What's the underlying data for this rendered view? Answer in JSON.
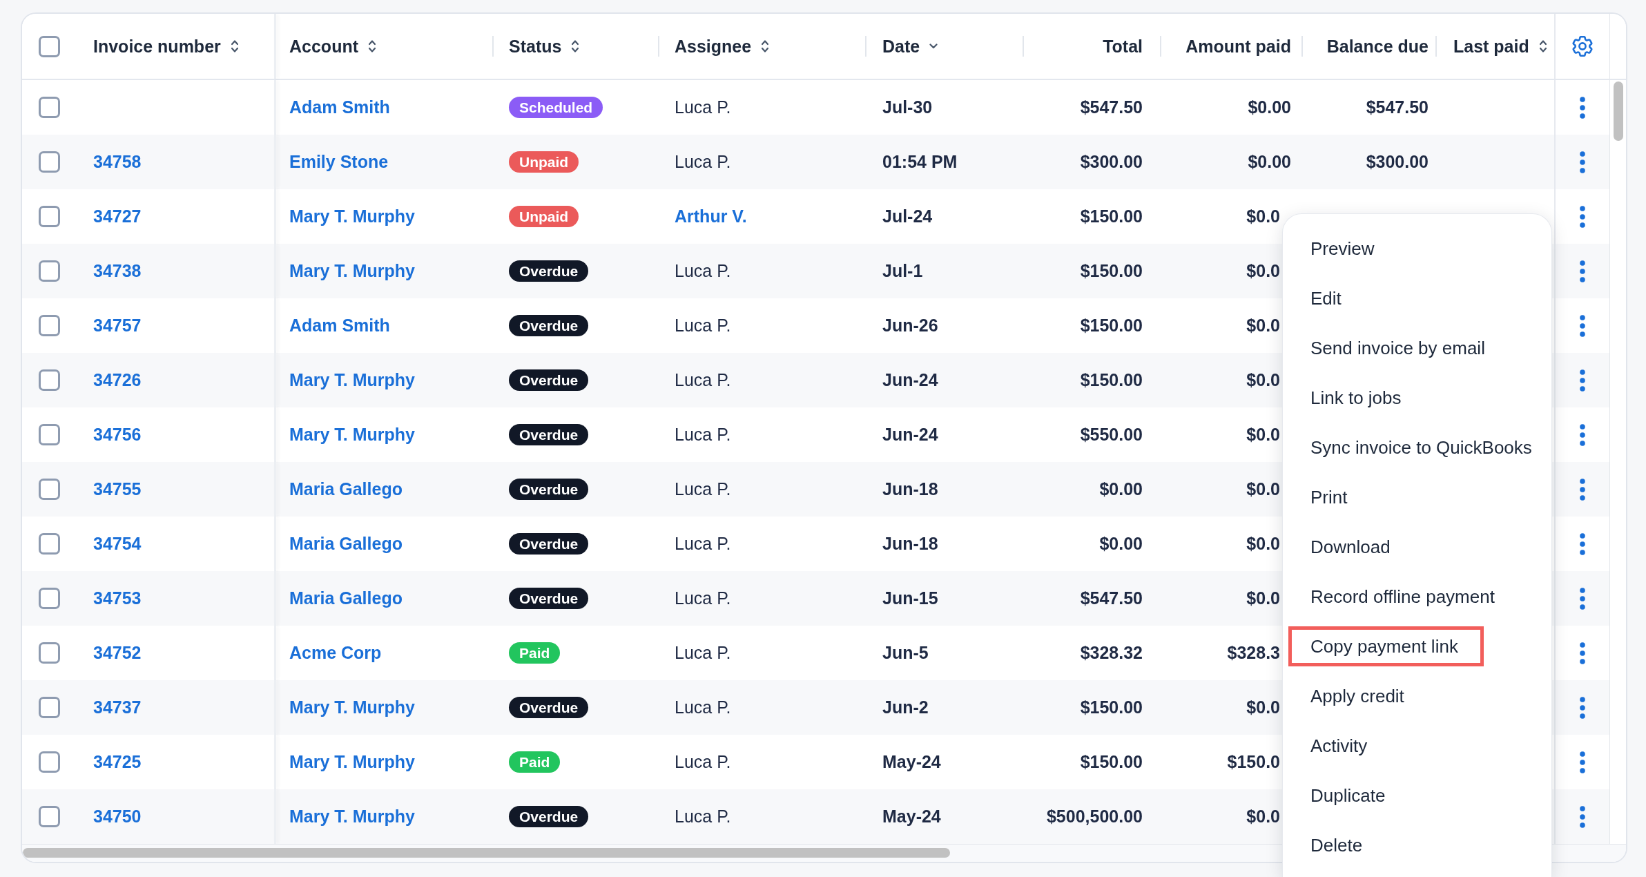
{
  "table": {
    "select_all": {
      "checked": false
    },
    "columns": [
      {
        "label": "Invoice number",
        "sortable": true,
        "sorted": false,
        "kind": "text"
      },
      {
        "label": "Account",
        "sortable": true,
        "sorted": false,
        "kind": "text"
      },
      {
        "label": "Status",
        "sortable": true,
        "sorted": false,
        "kind": "text"
      },
      {
        "label": "Assignee",
        "sortable": true,
        "sorted": false,
        "kind": "text"
      },
      {
        "label": "Date",
        "sortable": true,
        "sorted": true,
        "kind": "text"
      },
      {
        "label": "Total",
        "sortable": false,
        "sorted": false,
        "kind": "amount"
      },
      {
        "label": "Amount paid",
        "sortable": false,
        "sorted": false,
        "kind": "amount"
      },
      {
        "label": "Balance due",
        "sortable": false,
        "sorted": false,
        "kind": "amount"
      },
      {
        "label": "Last paid",
        "sortable": true,
        "sorted": false,
        "kind": "text"
      }
    ],
    "rows": [
      {
        "checked": false,
        "account": "Adam Smith",
        "status": {
          "label": "Scheduled",
          "color": "#8b5cf6"
        },
        "assignee": "Luca P.",
        "assignee_link": false,
        "date": "Jul-30",
        "total": "$547.50",
        "amount_paid": "$0.00",
        "balance_due": "$547.50",
        "menu_open": false
      },
      {
        "checked": false,
        "invoice_number": "34758",
        "account": "Emily Stone",
        "status": {
          "label": "Unpaid",
          "color": "#eb5a5a"
        },
        "assignee": "Luca P.",
        "assignee_link": false,
        "date": "01:54 PM",
        "total": "$300.00",
        "amount_paid": "$0.00",
        "balance_due": "$300.00",
        "menu_open": false
      },
      {
        "checked": false,
        "invoice_number": "34727",
        "account": "Mary T. Murphy",
        "status": {
          "label": "Unpaid",
          "color": "#eb5a5a"
        },
        "assignee": "Arthur V.",
        "assignee_link": true,
        "date": "Jul-24",
        "total": "$150.00",
        "amount_paid": "$0.0",
        "menu_open": true
      },
      {
        "checked": false,
        "invoice_number": "34738",
        "account": "Mary T. Murphy",
        "status": {
          "label": "Overdue",
          "color": "#111827"
        },
        "assignee": "Luca P.",
        "assignee_link": false,
        "date": "Jul-1",
        "total": "$150.00",
        "amount_paid": "$0.0",
        "menu_open": false
      },
      {
        "checked": false,
        "invoice_number": "34757",
        "account": "Adam Smith",
        "status": {
          "label": "Overdue",
          "color": "#111827"
        },
        "assignee": "Luca P.",
        "assignee_link": false,
        "date": "Jun-26",
        "total": "$150.00",
        "amount_paid": "$0.0",
        "menu_open": false
      },
      {
        "checked": false,
        "invoice_number": "34726",
        "account": "Mary T. Murphy",
        "status": {
          "label": "Overdue",
          "color": "#111827"
        },
        "assignee": "Luca P.",
        "assignee_link": false,
        "date": "Jun-24",
        "total": "$150.00",
        "amount_paid": "$0.0",
        "menu_open": false
      },
      {
        "checked": false,
        "invoice_number": "34756",
        "account": "Mary T. Murphy",
        "status": {
          "label": "Overdue",
          "color": "#111827"
        },
        "assignee": "Luca P.",
        "assignee_link": false,
        "date": "Jun-24",
        "total": "$550.00",
        "amount_paid": "$0.0",
        "menu_open": false
      },
      {
        "checked": false,
        "invoice_number": "34755",
        "account": "Maria Gallego",
        "status": {
          "label": "Overdue",
          "color": "#111827"
        },
        "assignee": "Luca P.",
        "assignee_link": false,
        "date": "Jun-18",
        "total": "$0.00",
        "amount_paid": "$0.0",
        "menu_open": false
      },
      {
        "checked": false,
        "invoice_number": "34754",
        "account": "Maria Gallego",
        "status": {
          "label": "Overdue",
          "color": "#111827"
        },
        "assignee": "Luca P.",
        "assignee_link": false,
        "date": "Jun-18",
        "total": "$0.00",
        "amount_paid": "$0.0",
        "menu_open": false
      },
      {
        "checked": false,
        "invoice_number": "34753",
        "account": "Maria Gallego",
        "status": {
          "label": "Overdue",
          "color": "#111827"
        },
        "assignee": "Luca P.",
        "assignee_link": false,
        "date": "Jun-15",
        "total": "$547.50",
        "amount_paid": "$0.0",
        "menu_open": false
      },
      {
        "checked": false,
        "invoice_number": "34752",
        "account": "Acme Corp",
        "status": {
          "label": "Paid",
          "color": "#22c55e"
        },
        "assignee": "Luca P.",
        "assignee_link": false,
        "date": "Jun-5",
        "total": "$328.32",
        "amount_paid": "$328.3",
        "menu_open": false
      },
      {
        "checked": false,
        "invoice_number": "34737",
        "account": "Mary T. Murphy",
        "status": {
          "label": "Overdue",
          "color": "#111827"
        },
        "assignee": "Luca P.",
        "assignee_link": false,
        "date": "Jun-2",
        "total": "$150.00",
        "amount_paid": "$0.0",
        "menu_open": false
      },
      {
        "checked": false,
        "invoice_number": "34725",
        "account": "Mary T. Murphy",
        "status": {
          "label": "Paid",
          "color": "#22c55e"
        },
        "assignee": "Luca P.",
        "assignee_link": false,
        "date": "May-24",
        "total": "$150.00",
        "amount_paid": "$150.0",
        "menu_open": false
      },
      {
        "checked": false,
        "invoice_number": "34750",
        "account": "Mary T. Murphy",
        "status": {
          "label": "Overdue",
          "color": "#111827"
        },
        "assignee": "Luca P.",
        "assignee_link": false,
        "date": "May-24",
        "total": "$500,500.00",
        "amount_paid": "$0.0",
        "menu_open": false
      }
    ]
  },
  "row_menu": {
    "items": [
      {
        "label": "Preview",
        "highlighted": false
      },
      {
        "label": "Edit",
        "highlighted": false
      },
      {
        "label": "Send invoice by email",
        "highlighted": false
      },
      {
        "label": "Link to jobs",
        "highlighted": false
      },
      {
        "label": "Sync invoice to QuickBooks",
        "highlighted": false
      },
      {
        "label": "Print",
        "highlighted": false
      },
      {
        "label": "Download",
        "highlighted": false
      },
      {
        "label": "Record offline payment",
        "highlighted": false
      },
      {
        "label": "Copy payment link",
        "highlighted": true
      },
      {
        "label": "Apply credit",
        "highlighted": false
      },
      {
        "label": "Activity",
        "highlighted": false
      },
      {
        "label": "Duplicate",
        "highlighted": false
      },
      {
        "label": "Delete",
        "highlighted": false
      }
    ]
  }
}
